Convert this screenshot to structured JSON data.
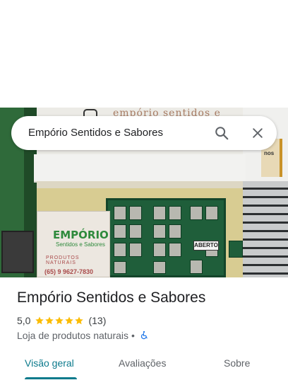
{
  "search": {
    "query": "Empório Sentidos e Sabores",
    "icons": [
      "search-icon",
      "close-icon"
    ]
  },
  "photo": {
    "sign_text": "empório sentidos e sabores",
    "banner_title": "EMPÓRIO",
    "banner_subtitle": "Sentidos e Sabores",
    "banner_tagline": "PRODUTOS NATURAIS",
    "banner_phone": "(65) 9 9627-7830",
    "door_sign": "ABERTO",
    "side_sign": "nos"
  },
  "place": {
    "name": "Empório Sentidos e Sabores",
    "rating": "5,0",
    "stars": 5,
    "review_count": "(13)",
    "category": "Loja de produtos naturais",
    "separator": "•",
    "accessibility_icon": "wheelchair-icon"
  },
  "tabs": [
    {
      "label": "Visão geral",
      "active": true
    },
    {
      "label": "Avaliações",
      "active": false
    },
    {
      "label": "Sobre",
      "active": false
    }
  ],
  "colors": {
    "accent": "#0b7a8c",
    "star": "#fbbc04",
    "accessibility": "#1a73e8"
  }
}
